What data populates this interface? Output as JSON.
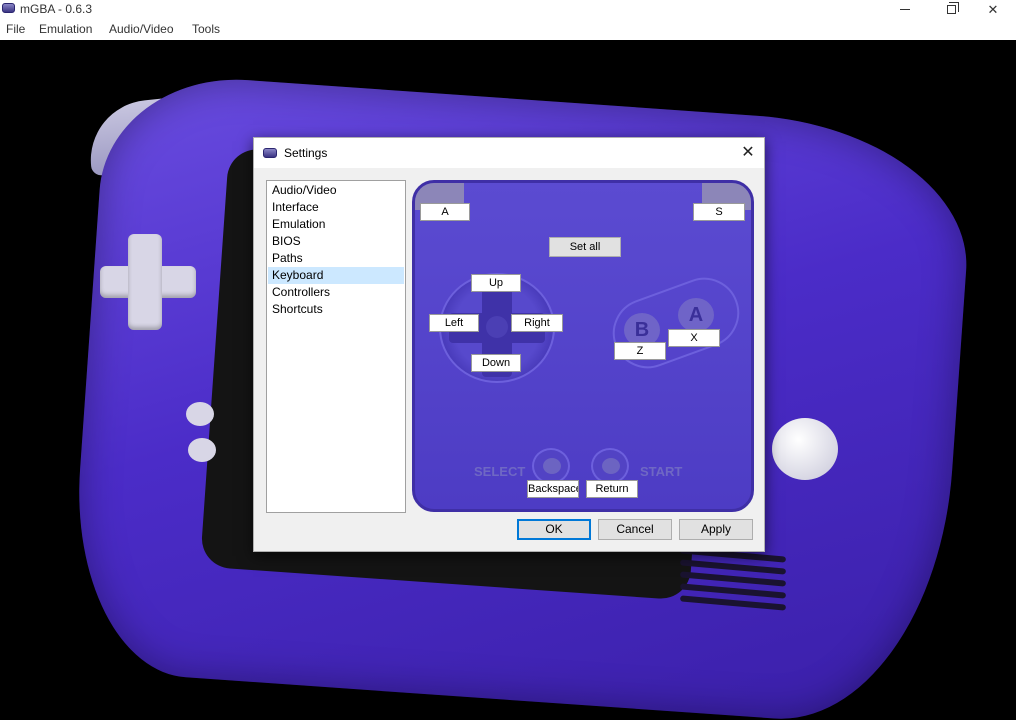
{
  "window": {
    "title": "mGBA - 0.6.3",
    "menu": [
      "File",
      "Emulation",
      "Audio/Video",
      "Tools"
    ]
  },
  "dialog": {
    "title": "Settings",
    "categories": [
      "Audio/Video",
      "Interface",
      "Emulation",
      "BIOS",
      "Paths",
      "Keyboard",
      "Controllers",
      "Shortcuts"
    ],
    "selected_category": "Keyboard",
    "mapping": {
      "l": "A",
      "r": "S",
      "set_all": "Set all",
      "up": "Up",
      "left": "Left",
      "right": "Right",
      "down": "Down",
      "b": "Z",
      "a": "X",
      "select": "Backspace",
      "start": "Return"
    },
    "pad_labels": {
      "select": "SELECT",
      "start": "START",
      "button_a": "A",
      "button_b": "B"
    },
    "buttons": {
      "ok": "OK",
      "cancel": "Cancel",
      "apply": "Apply"
    }
  }
}
